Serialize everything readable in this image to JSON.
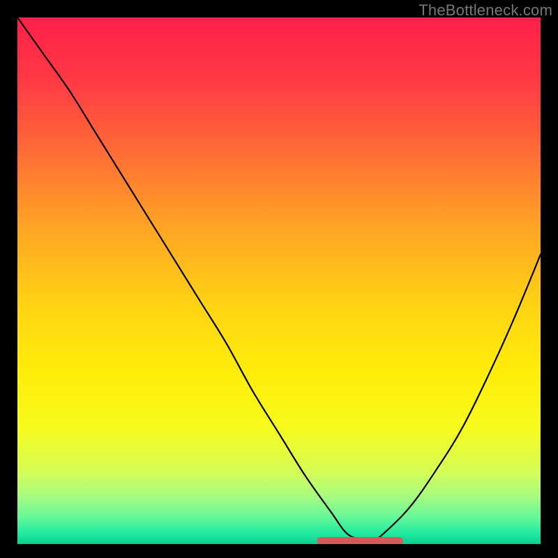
{
  "watermark": "TheBottleneck.com",
  "chart_data": {
    "type": "line",
    "title": "",
    "xlabel": "",
    "ylabel": "",
    "xlim": [
      0,
      100
    ],
    "ylim": [
      0,
      100
    ],
    "grid": false,
    "legend": false,
    "curve": {
      "name": "bottleneck-curve",
      "x": [
        0,
        5,
        10,
        15,
        20,
        25,
        30,
        35,
        40,
        45,
        50,
        55,
        60,
        63,
        66,
        68,
        70,
        75,
        80,
        85,
        90,
        95,
        100
      ],
      "y": [
        100,
        93,
        86,
        78,
        70,
        62,
        54,
        46,
        38,
        29,
        21,
        13,
        6,
        2,
        0.8,
        0.8,
        2,
        7,
        14,
        22,
        32,
        43,
        55
      ]
    },
    "optimal_band": {
      "x_start": 58,
      "x_end": 73,
      "y": 0.6
    },
    "gradient_stops": [
      {
        "pct": 0,
        "color": "#ff1f4a"
      },
      {
        "pct": 12,
        "color": "#ff3a44"
      },
      {
        "pct": 25,
        "color": "#ff6a36"
      },
      {
        "pct": 40,
        "color": "#ffa524"
      },
      {
        "pct": 55,
        "color": "#ffd413"
      },
      {
        "pct": 68,
        "color": "#ffee0a"
      },
      {
        "pct": 78,
        "color": "#f6fb1e"
      },
      {
        "pct": 86,
        "color": "#d7fd55"
      },
      {
        "pct": 91,
        "color": "#a6fc7f"
      },
      {
        "pct": 95,
        "color": "#63f79a"
      },
      {
        "pct": 98,
        "color": "#20eaa0"
      },
      {
        "pct": 100,
        "color": "#08cf8f"
      }
    ]
  }
}
